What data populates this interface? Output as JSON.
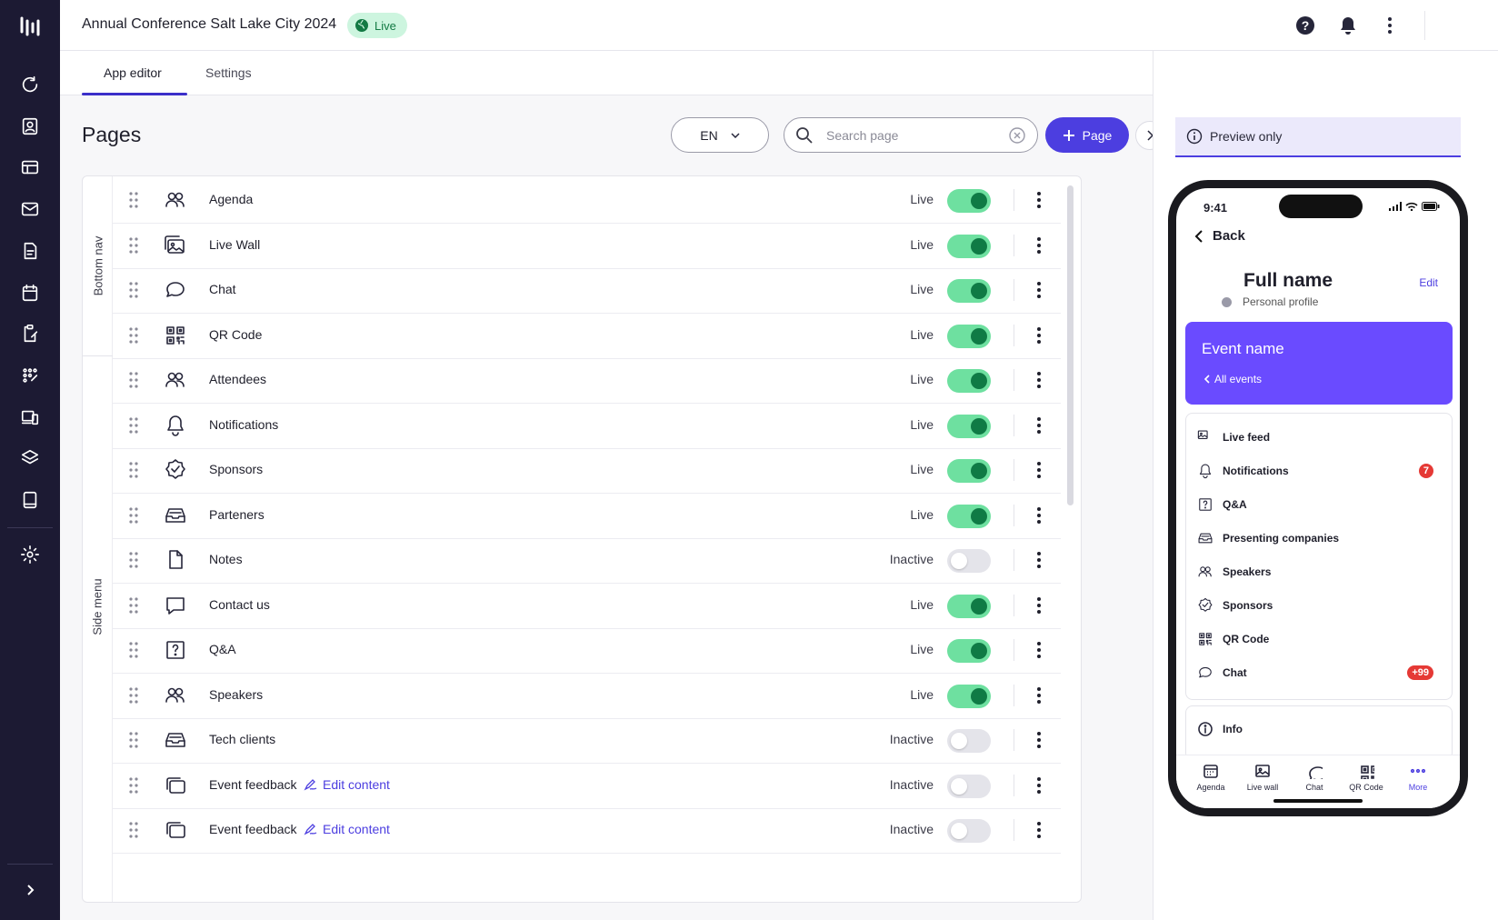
{
  "app": {
    "title": "Annual Conference Salt Lake City 2024",
    "status_badge": "Live",
    "accent_color": "#4c3ee0",
    "rail_color": "#1c1a33"
  },
  "rail": {
    "items": [
      {
        "icon": "refresh-icon"
      },
      {
        "icon": "contact-card-icon"
      },
      {
        "icon": "browser-icon"
      },
      {
        "icon": "mail-icon"
      },
      {
        "icon": "document-icon"
      },
      {
        "icon": "calendar-icon"
      },
      {
        "icon": "clipboard-edit-icon"
      },
      {
        "icon": "dots-grid-icon"
      },
      {
        "icon": "devices-icon"
      },
      {
        "icon": "layers-icon"
      },
      {
        "icon": "tablet-icon"
      },
      {
        "icon": "gear-icon"
      }
    ]
  },
  "tabs": [
    {
      "label": "App editor",
      "active": true
    },
    {
      "label": "Settings",
      "active": false
    }
  ],
  "editor": {
    "title": "Pages",
    "language": "EN",
    "search_placeholder": "Search page",
    "add_page_label": "Page",
    "groups": [
      "Bottom nav",
      "Side menu"
    ],
    "edit_content_label": "Edit content",
    "rows": [
      {
        "label": "Agenda",
        "icon": "people-icon",
        "status": "Live",
        "on": true
      },
      {
        "label": "Live Wall",
        "icon": "images-icon",
        "status": "Live",
        "on": true
      },
      {
        "label": "Chat",
        "icon": "chat-icon",
        "status": "Live",
        "on": true
      },
      {
        "label": "QR Code",
        "icon": "qr-code-icon",
        "status": "Live",
        "on": true
      },
      {
        "label": "Attendees",
        "icon": "people-icon",
        "status": "Live",
        "on": true
      },
      {
        "label": "Notifications",
        "icon": "bell-icon",
        "status": "Live",
        "on": true
      },
      {
        "label": "Sponsors",
        "icon": "badge-check-icon",
        "status": "Live",
        "on": true
      },
      {
        "label": "Parteners",
        "icon": "inbox-icon",
        "status": "Live",
        "on": true
      },
      {
        "label": "Notes",
        "icon": "file-icon",
        "status": "Inactive",
        "on": false
      },
      {
        "label": "Contact us",
        "icon": "message-square-icon",
        "status": "Live",
        "on": true
      },
      {
        "label": "Q&A",
        "icon": "question-box-icon",
        "status": "Live",
        "on": true
      },
      {
        "label": "Speakers",
        "icon": "people-icon",
        "status": "Live",
        "on": true
      },
      {
        "label": "Tech clients",
        "icon": "inbox-icon",
        "status": "Inactive",
        "on": false
      },
      {
        "label": "Event feedback",
        "icon": "cards-icon",
        "status": "Inactive",
        "on": false,
        "edit": true
      },
      {
        "label": "Event feedback",
        "icon": "cards-icon",
        "status": "Inactive",
        "on": false,
        "edit": true
      }
    ]
  },
  "preview": {
    "banner": "Preview only",
    "phone": {
      "time": "9:41",
      "back_label": "Back",
      "full_name": "Full name",
      "edit_label": "Edit",
      "profile_label": "Personal profile",
      "event_name": "Event name",
      "all_events": "All events",
      "menu": [
        {
          "label": "Live feed",
          "icon": "image-icon"
        },
        {
          "label": "Notifications",
          "icon": "bell-icon",
          "count": "7"
        },
        {
          "label": "Q&A",
          "icon": "question-box-icon"
        },
        {
          "label": "Presenting companies",
          "icon": "inbox-icon"
        },
        {
          "label": "Speakers",
          "icon": "people-icon"
        },
        {
          "label": "Sponsors",
          "icon": "badge-check-icon"
        },
        {
          "label": "QR Code",
          "icon": "qr-code-icon"
        },
        {
          "label": "Chat",
          "icon": "chat-icon",
          "count": "+99"
        }
      ],
      "info_label": "Info",
      "tabbar": [
        {
          "label": "Agenda",
          "icon": "calendar-grid-icon"
        },
        {
          "label": "Live wall",
          "icon": "image-icon"
        },
        {
          "label": "Chat",
          "icon": "chat-icon"
        },
        {
          "label": "QR Code",
          "icon": "qr-code-icon"
        },
        {
          "label": "More",
          "icon": "more-dots-icon",
          "active": true
        }
      ]
    }
  }
}
